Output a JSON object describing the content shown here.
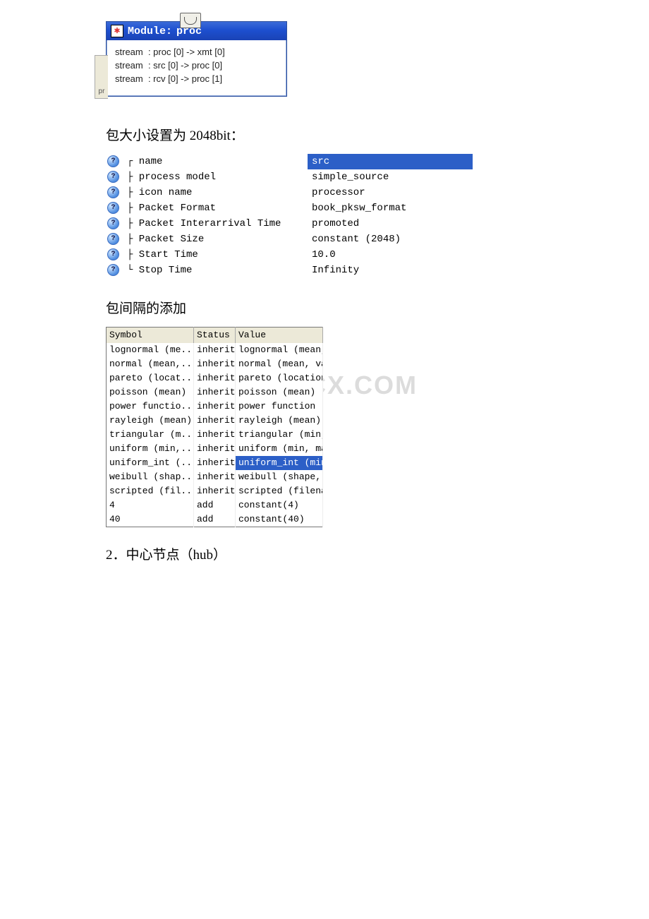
{
  "module": {
    "title_label": "Module:",
    "title_value": "proc",
    "star_glyph": "✱",
    "left_stub": "pr",
    "streams": [
      "stream  : proc [0] -> xmt [0]",
      "stream  : src [0] -> proc [0]",
      "stream  : rcv [0] -> proc [1]"
    ]
  },
  "para_packet_size": "包大小设置为 2048bit：",
  "attr_table": {
    "rows": [
      {
        "tree": "┌",
        "name": "name",
        "value": "src",
        "selected": true
      },
      {
        "tree": "├",
        "name": "process model",
        "value": "simple_source",
        "selected": false
      },
      {
        "tree": "├",
        "name": "icon name",
        "value": "processor",
        "selected": false
      },
      {
        "tree": "├",
        "name": "Packet Format",
        "value": "book_pksw_format",
        "selected": false
      },
      {
        "tree": "├",
        "name": "Packet Interarrival Time",
        "value": "promoted",
        "selected": false
      },
      {
        "tree": "├",
        "name": "Packet Size",
        "value": "constant (2048)",
        "selected": false
      },
      {
        "tree": "├",
        "name": "Start Time",
        "value": "10.0",
        "selected": false
      },
      {
        "tree": "└",
        "name": "Stop Time",
        "value": "Infinity",
        "selected": false
      }
    ]
  },
  "para_interval": "包间隔的添加",
  "sym_table": {
    "headers": {
      "symbol": "Symbol",
      "status": "Status",
      "value": "Value"
    },
    "rows": [
      {
        "symbol": "lognormal (me...",
        "status": "inherit",
        "value": "lognormal (mean, va",
        "hl": false
      },
      {
        "symbol": "normal (mean,...",
        "status": "inherit",
        "value": "normal (mean, varia",
        "hl": false
      },
      {
        "symbol": "pareto (locat...",
        "status": "inherit",
        "value": "pareto (location, s",
        "hl": false
      },
      {
        "symbol": "poisson (mean)",
        "status": "inherit",
        "value": "poisson (mean)",
        "hl": false
      },
      {
        "symbol": "power functio...",
        "status": "inherit",
        "value": "power function (sha",
        "hl": false
      },
      {
        "symbol": "rayleigh (mean)",
        "status": "inherit",
        "value": "rayleigh (mean)",
        "hl": false
      },
      {
        "symbol": "triangular (m...",
        "status": "inherit",
        "value": "triangular (min, ma",
        "hl": false
      },
      {
        "symbol": "uniform (min,...",
        "status": "inherit",
        "value": "uniform (min, max)",
        "hl": false
      },
      {
        "symbol": "uniform_int (...",
        "status": "inherit",
        "value": "uniform_int (min, m",
        "hl": true
      },
      {
        "symbol": "weibull (shap...",
        "status": "inherit",
        "value": "weibull (shape, sca",
        "hl": false
      },
      {
        "symbol": "scripted (fil...",
        "status": "inherit",
        "value": "scripted (filename)",
        "hl": false
      },
      {
        "symbol": "4",
        "status": "add",
        "value": "constant(4)",
        "hl": false
      },
      {
        "symbol": "40",
        "status": "add",
        "value": "constant(40)",
        "hl": false
      }
    ]
  },
  "watermark": "CX.COM",
  "para_hub": "2．中心节点（hub）"
}
